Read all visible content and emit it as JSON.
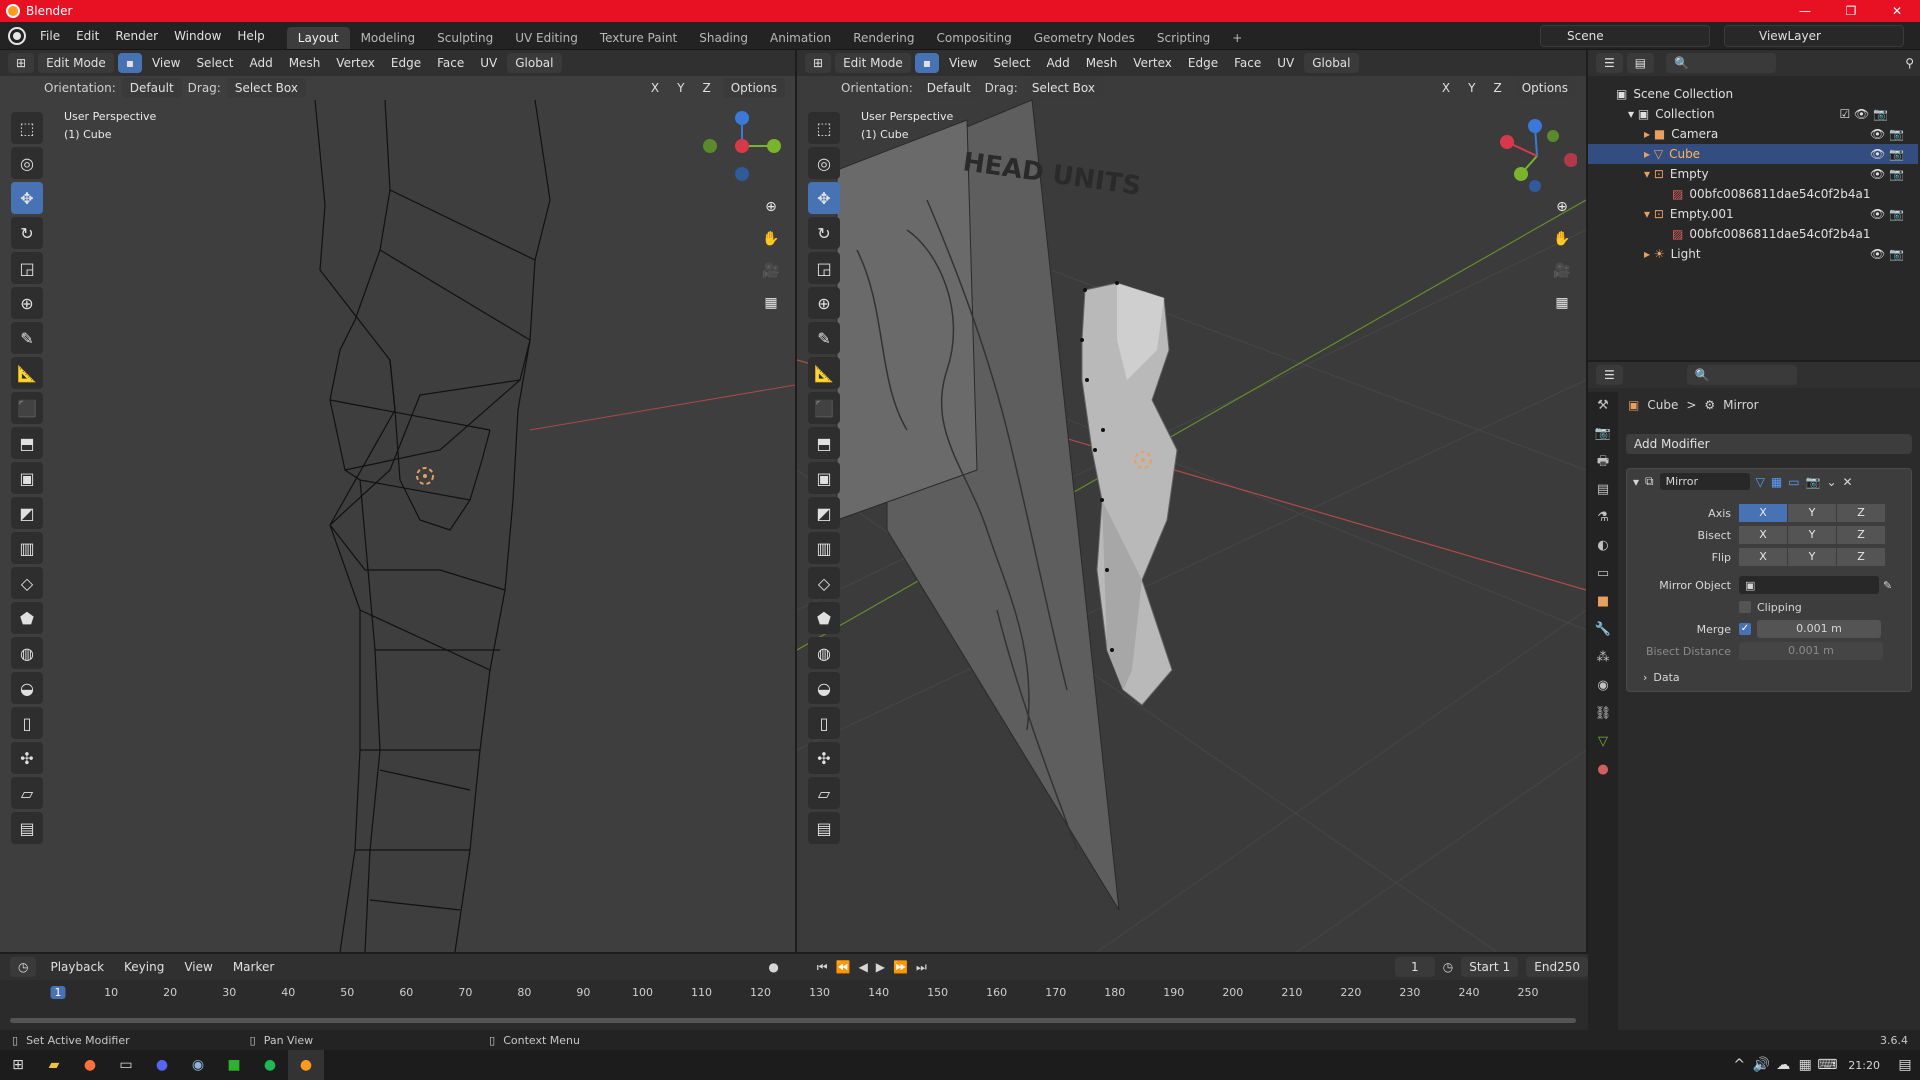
{
  "window": {
    "title": "Blender",
    "min": "—",
    "max": "❐",
    "close": "✕"
  },
  "menu": [
    "File",
    "Edit",
    "Render",
    "Window",
    "Help"
  ],
  "workspaces": [
    {
      "label": "Layout",
      "active": true
    },
    {
      "label": "Modeling"
    },
    {
      "label": "Sculpting"
    },
    {
      "label": "UV Editing"
    },
    {
      "label": "Texture Paint"
    },
    {
      "label": "Shading"
    },
    {
      "label": "Animation"
    },
    {
      "label": "Rendering"
    },
    {
      "label": "Compositing"
    },
    {
      "label": "Geometry Nodes"
    },
    {
      "label": "Scripting"
    }
  ],
  "add_workspace": "+",
  "scene": "Scene",
  "view_layer": "ViewLayer",
  "viewport_header": {
    "mode": "Edit Mode",
    "menus": [
      "View",
      "Select",
      "Add",
      "Mesh",
      "Vertex",
      "Edge",
      "Face",
      "UV"
    ],
    "transform": "Global",
    "orientation_label": "Orientation:",
    "orientation_value": "Default",
    "drag_label": "Drag:",
    "drag_value": "Select Box",
    "options": "Options",
    "axes": [
      "X",
      "Y",
      "Z"
    ]
  },
  "left_viewport": {
    "line1": "User Perspective",
    "line2": "(1) Cube"
  },
  "right_viewport": {
    "line1": "User Perspective",
    "line2": "(1) Cube",
    "reference_text": "HEAD UNITS"
  },
  "outliner": {
    "title": "Scene Collection",
    "rows": [
      {
        "label": "Collection"
      },
      {
        "label": "Camera"
      },
      {
        "label": "Cube",
        "selected": true
      },
      {
        "label": "Empty"
      },
      {
        "label": "00bfc0086811dae54c0f2b4a1"
      },
      {
        "label": "Empty.001"
      },
      {
        "label": "00bfc0086811dae54c0f2b4a1"
      },
      {
        "label": "Light"
      }
    ]
  },
  "properties": {
    "breadcrumb_object": "Cube",
    "breadcrumb_sep": ">",
    "breadcrumb_modifier": "Mirror",
    "add_modifier": "Add Modifier",
    "modifier_name": "Mirror",
    "axis_label": "Axis",
    "bisect_label": "Bisect",
    "flip_label": "Flip",
    "xyz": [
      "X",
      "Y",
      "Z"
    ],
    "mirror_object_label": "Mirror Object",
    "clipping_label": "Clipping",
    "merge_label": "Merge",
    "merge_value": "0.001 m",
    "bisect_distance_label": "Bisect Distance",
    "bisect_distance_value": "0.001 m",
    "data_label": "Data"
  },
  "timeline": {
    "menus": [
      "Playback",
      "Keying",
      "View",
      "Marker"
    ],
    "current_frame": "1",
    "start_label": "Start",
    "start": "1",
    "end_label": "End",
    "end": "250",
    "ticks": [
      "1",
      "10",
      "20",
      "30",
      "40",
      "50",
      "60",
      "70",
      "80",
      "90",
      "100",
      "110",
      "120",
      "130",
      "140",
      "150",
      "160",
      "170",
      "180",
      "190",
      "200",
      "210",
      "220",
      "230",
      "240",
      "250"
    ]
  },
  "statusbar": {
    "left": "Set Active Modifier",
    "mid": "Pan View",
    "right": "Context Menu",
    "version": "3.6.4"
  },
  "taskbar": {
    "time": "21:20"
  },
  "colors": {
    "accent": "#4772b3",
    "title_red": "#e81123",
    "x_axis": "#d63a4a",
    "y_axis": "#7ab32c",
    "z_axis": "#3b78d8"
  }
}
